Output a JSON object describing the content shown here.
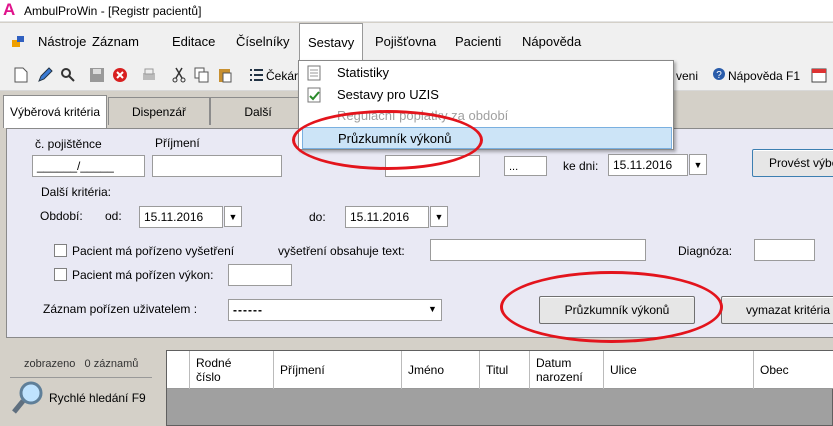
{
  "window": {
    "title": "AmbulProWin  - [Registr pacientů]",
    "logo": "A"
  },
  "menu": {
    "items": [
      "Nástroje",
      "Záznam",
      "Editace",
      "Číselníky",
      "Sestavy",
      "Pojišťovna",
      "Pacienti",
      "Nápověda"
    ]
  },
  "sestavy_menu": {
    "items": [
      "Statistiky",
      "Sestavy pro UZIS",
      "Regulační poplatky za období",
      "Průzkumník výkonů"
    ]
  },
  "toolbar": {
    "cekar_label": "Čekár",
    "veni_label": "veni",
    "napoveda_label": "Nápověda F1"
  },
  "tabs": [
    "Výběrová kritéria",
    "Dispenzář",
    "Další"
  ],
  "filters": {
    "pojistence_label": "č. pojištěnce",
    "pojistence_value": "______/_____",
    "prijmeni_label": "Příjmení",
    "ellipsis": "...",
    "ke_dni_label": "ke dni:",
    "ke_dni_value": "15.11.2016",
    "provest_label": "Provést výběr",
    "dalsi_kriteria_label": "Další kritéria:",
    "obdobi_label": "Období:",
    "od_label": "od:",
    "od_value": "15.11.2016",
    "do_label": "do:",
    "do_value": "15.11.2016",
    "vysetreni_chk_label": "Pacient má pořízeno vyšetření",
    "vysetreni_text_label": "vyšetření obsahuje text:",
    "diagnoza_label": "Diagnóza:",
    "vykon_chk_label": "Pacient má pořízen výkon:",
    "zaznam_label": "Záznam pořízen uživatelem :",
    "zaznam_value": "------",
    "pruzkumnik_button": "Průzkumník výkonů",
    "vymazat_button": "vymazat kritéria výběru"
  },
  "left_panel": {
    "zobrazeno": "zobrazeno   0 záznamů",
    "rychle_hledani": "Rychlé hledání F9"
  },
  "grid": {
    "columns": [
      "Rodné\nčíslo",
      "Příjmení",
      "Jméno",
      "Titul",
      "Datum\nnarození",
      "Ulice",
      "Obec"
    ]
  },
  "colors": {
    "highlight_oval": "#e3141c",
    "menu_highlight": "#cce4f7",
    "panel_bg": "#e9e9f4"
  }
}
